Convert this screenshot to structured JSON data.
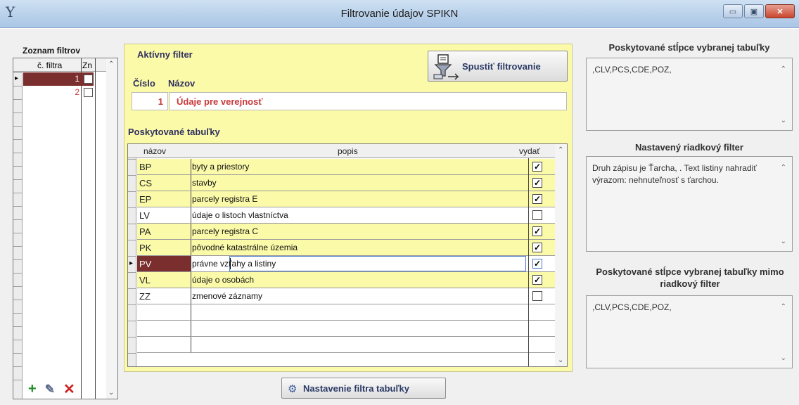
{
  "window": {
    "title": "Filtrovanie údajov SPIKN",
    "app_icon": "Y",
    "buttons": {
      "minimize": "▭",
      "maximize": "▣",
      "close": "✕"
    }
  },
  "filters": {
    "title": "Zoznam filtrov",
    "col_number": "č. filtra",
    "col_flag": "Zn",
    "rows": [
      {
        "number": "1",
        "checked": false,
        "selected": true
      },
      {
        "number": "2",
        "checked": false,
        "selected": false
      }
    ]
  },
  "toolbar": {
    "add_icon": "+",
    "edit_icon": "✎",
    "delete_icon": "✕"
  },
  "active_filter": {
    "title": "Aktívny filter",
    "cislo_label": "Číslo",
    "nazov_label": "Názov",
    "cislo": "1",
    "nazov": "Údaje pre verejnosť",
    "run_button": "Spustiť filtrovanie"
  },
  "tables": {
    "title": "Poskytované tabuľky",
    "col_name": "názov",
    "col_desc": "popis",
    "col_export": "vydať",
    "rows": [
      {
        "name": "BP",
        "desc": "byty a priestory",
        "checked": true,
        "highlight": true
      },
      {
        "name": "CS",
        "desc": "stavby",
        "checked": true,
        "highlight": true
      },
      {
        "name": "EP",
        "desc": "parcely registra E",
        "checked": true,
        "highlight": true
      },
      {
        "name": "LV",
        "desc": "údaje o listoch vlastníctva",
        "checked": false,
        "highlight": false
      },
      {
        "name": "PA",
        "desc": "parcely registra C",
        "checked": true,
        "highlight": true
      },
      {
        "name": "PK",
        "desc": "pôvodné katastrálne územia",
        "checked": true,
        "highlight": true
      },
      {
        "name": "PV",
        "desc": "právne vzťahy a listiny",
        "checked": true,
        "highlight": false,
        "selected": true
      },
      {
        "name": "VL",
        "desc": "údaje o osobách",
        "checked": true,
        "highlight": true
      },
      {
        "name": "ZZ",
        "desc": "zmenové záznamy",
        "checked": false,
        "highlight": false
      }
    ],
    "settings_button": "Nastavenie filtra tabuľky"
  },
  "right": {
    "columns_title": "Poskytované stĺpce vybranej tabuľky",
    "columns_value": ",CLV,PCS,CDE,POZ,",
    "row_filter_title": "Nastavený riadkový filter",
    "row_filter_value": "Druh zápisu je Ťarcha, . Text listiny nahradiť výrazom: nehnuteľnosť s ťarchou.",
    "columns_out_title": "Poskytované stĺpce vybranej tabuľky mimo riadkový filter",
    "columns_out_value": ",CLV,PCS,CDE,POZ,"
  },
  "colors": {
    "panel_yellow": "#fbfaa9",
    "selected_row": "#7b2e2e",
    "accent_red": "#c8383b"
  },
  "icons": [
    "app-logo-icon",
    "minimize-icon",
    "maximize-icon",
    "close-icon",
    "add-icon",
    "edit-icon",
    "delete-icon",
    "filter-run-icon",
    "settings-gear-icon",
    "scroll-up-icon",
    "scroll-down-icon"
  ]
}
